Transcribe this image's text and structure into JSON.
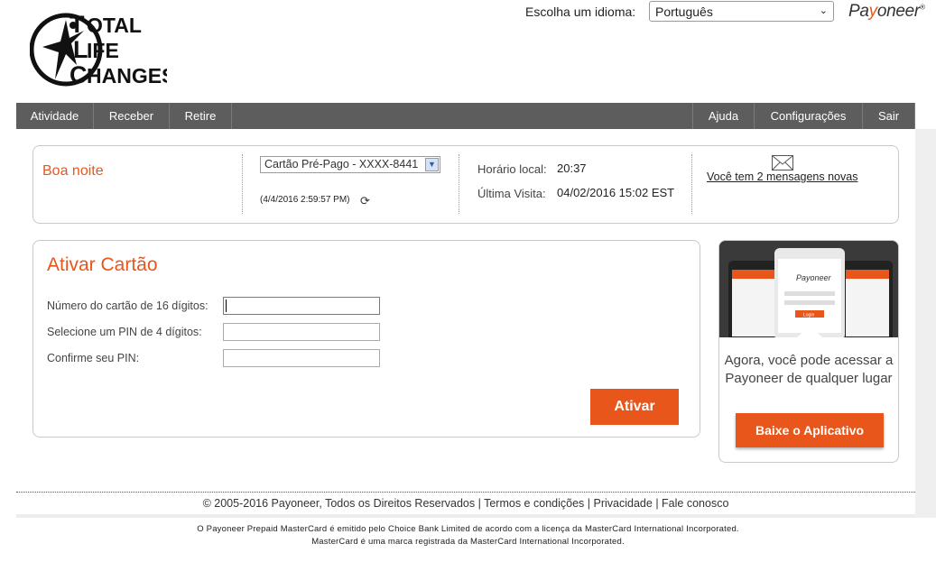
{
  "header": {
    "logo_alt": "TOTAL LIFE CHANGES",
    "logo_lines": [
      "OTAL",
      "IFE",
      "HANGES"
    ],
    "logo_letters": [
      "T",
      "L",
      "C"
    ],
    "language_label": "Escolha um idioma:",
    "language_selected": "Português",
    "brand_pre": "Pa",
    "brand_accent": "y",
    "brand_post": "oneer",
    "brand_mark": "®"
  },
  "nav": {
    "left": [
      "Atividade",
      "Receber",
      "Retire"
    ],
    "right": [
      "Ajuda",
      "Configurações",
      "Sair"
    ]
  },
  "welcome": {
    "greeting": "Boa noite",
    "card_selected": "Cartão Pré-Pago - XXXX-8441",
    "card_timestamp": "(4/4/2016 2:59:57 PM)",
    "local_time_label": "Horário local:",
    "local_time_value": "20:37",
    "last_visit_label": "Última Visita:",
    "last_visit_value": "04/02/2016 15:02 EST",
    "messages_link": "Você tem 2 mensagens novas"
  },
  "activate": {
    "title": "Ativar Cartão",
    "fields": [
      {
        "label": "Número do cartão de 16 dígitos:",
        "value": ""
      },
      {
        "label": "Selecione um PIN de 4 dígitos:",
        "value": ""
      },
      {
        "label": "Confirme seu PIN:",
        "value": ""
      }
    ],
    "button": "Ativar"
  },
  "promo": {
    "phone_brand": "Payoneer",
    "phone_button": "Login",
    "text": "Agora, você pode acessar a Payoneer de qualquer lugar",
    "button": "Baixe o Aplicativo"
  },
  "footer": {
    "copyright": "© 2005-2016 Payoneer, Todos os Direitos Reservados",
    "sep": "|",
    "terms": "Termos e condições",
    "privacy": "Privacidade",
    "contact": "Fale conosco",
    "legal_1": "O Payoneer Prepaid MasterCard é emitido pelo Choice Bank Limited de acordo com a licença da MasterCard International Incorporated.",
    "legal_2": "MasterCard é uma marca registrada da MasterCard International Incorporated."
  },
  "colors": {
    "accent": "#e8561b",
    "nav_bg": "#5d5d5d"
  }
}
